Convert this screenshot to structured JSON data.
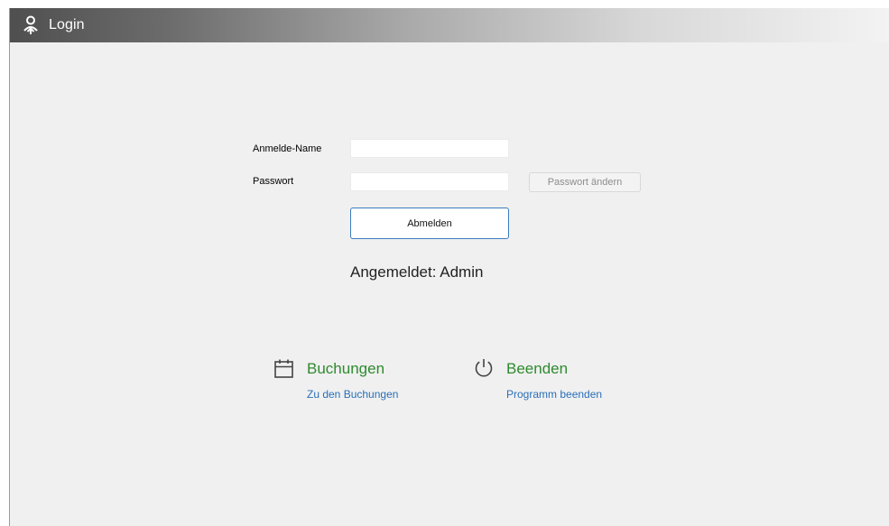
{
  "window": {
    "title": "Login",
    "title_icon": "user-icon"
  },
  "form": {
    "username_label": "Anmelde-Name",
    "username_value": "",
    "password_label": "Passwort",
    "password_value": "",
    "change_password_label": "Passwort ändern",
    "logout_button_label": "Abmelden",
    "status_text": "Angemeldet: Admin"
  },
  "tiles": [
    {
      "icon": "calendar-icon",
      "title": "Buchungen",
      "link": "Zu den Buchungen"
    },
    {
      "icon": "power-icon",
      "title": "Beenden",
      "link": "Programm beenden"
    }
  ],
  "colors": {
    "tile_title": "#2e8b2e",
    "link": "#2a6fb8",
    "primary_button_border": "#3b7bbf",
    "background": "#f0f0f0"
  }
}
